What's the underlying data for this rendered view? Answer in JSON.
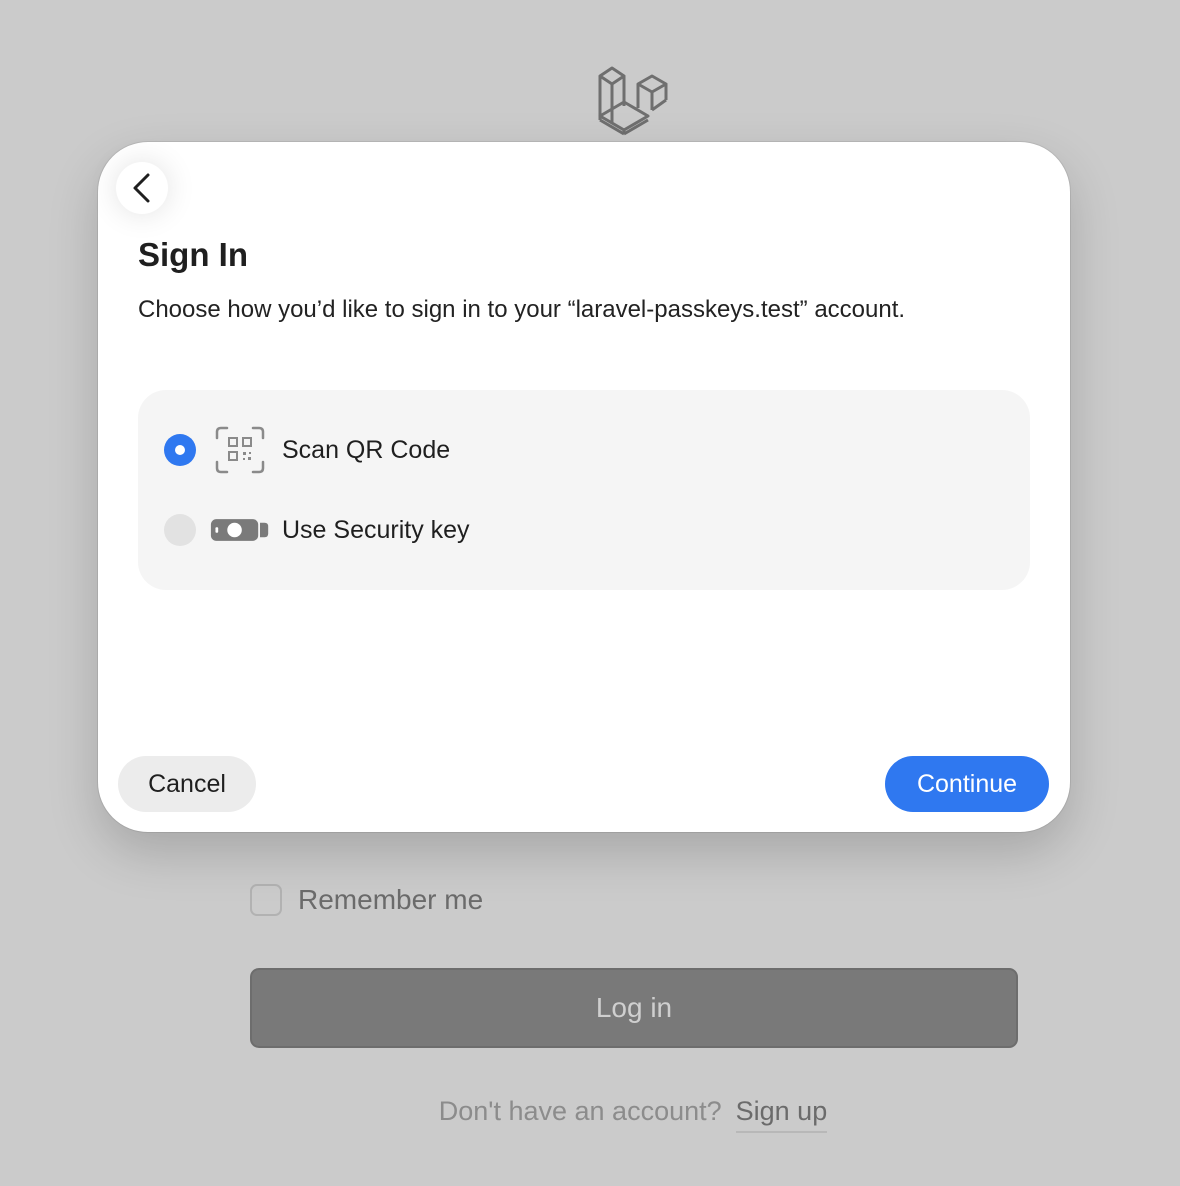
{
  "app": {
    "logo_icon": "laravel-logo-icon"
  },
  "login_form": {
    "remember_label": "Remember me",
    "remember_checked": false,
    "login_button": "Log in",
    "signup_prompt": "Don't have an account?",
    "signup_link": "Sign up"
  },
  "dialog": {
    "back_icon": "chevron-left-icon",
    "title": "Sign In",
    "subtitle": "Choose how you’d like to sign in to your “laravel-passkeys.test” account.",
    "options": [
      {
        "label": "Scan QR Code",
        "icon": "qr-code-icon",
        "selected": true
      },
      {
        "label": "Use Security key",
        "icon": "security-key-icon",
        "selected": false
      }
    ],
    "cancel_label": "Cancel",
    "continue_label": "Continue",
    "accent_color": "#2f78f0"
  }
}
